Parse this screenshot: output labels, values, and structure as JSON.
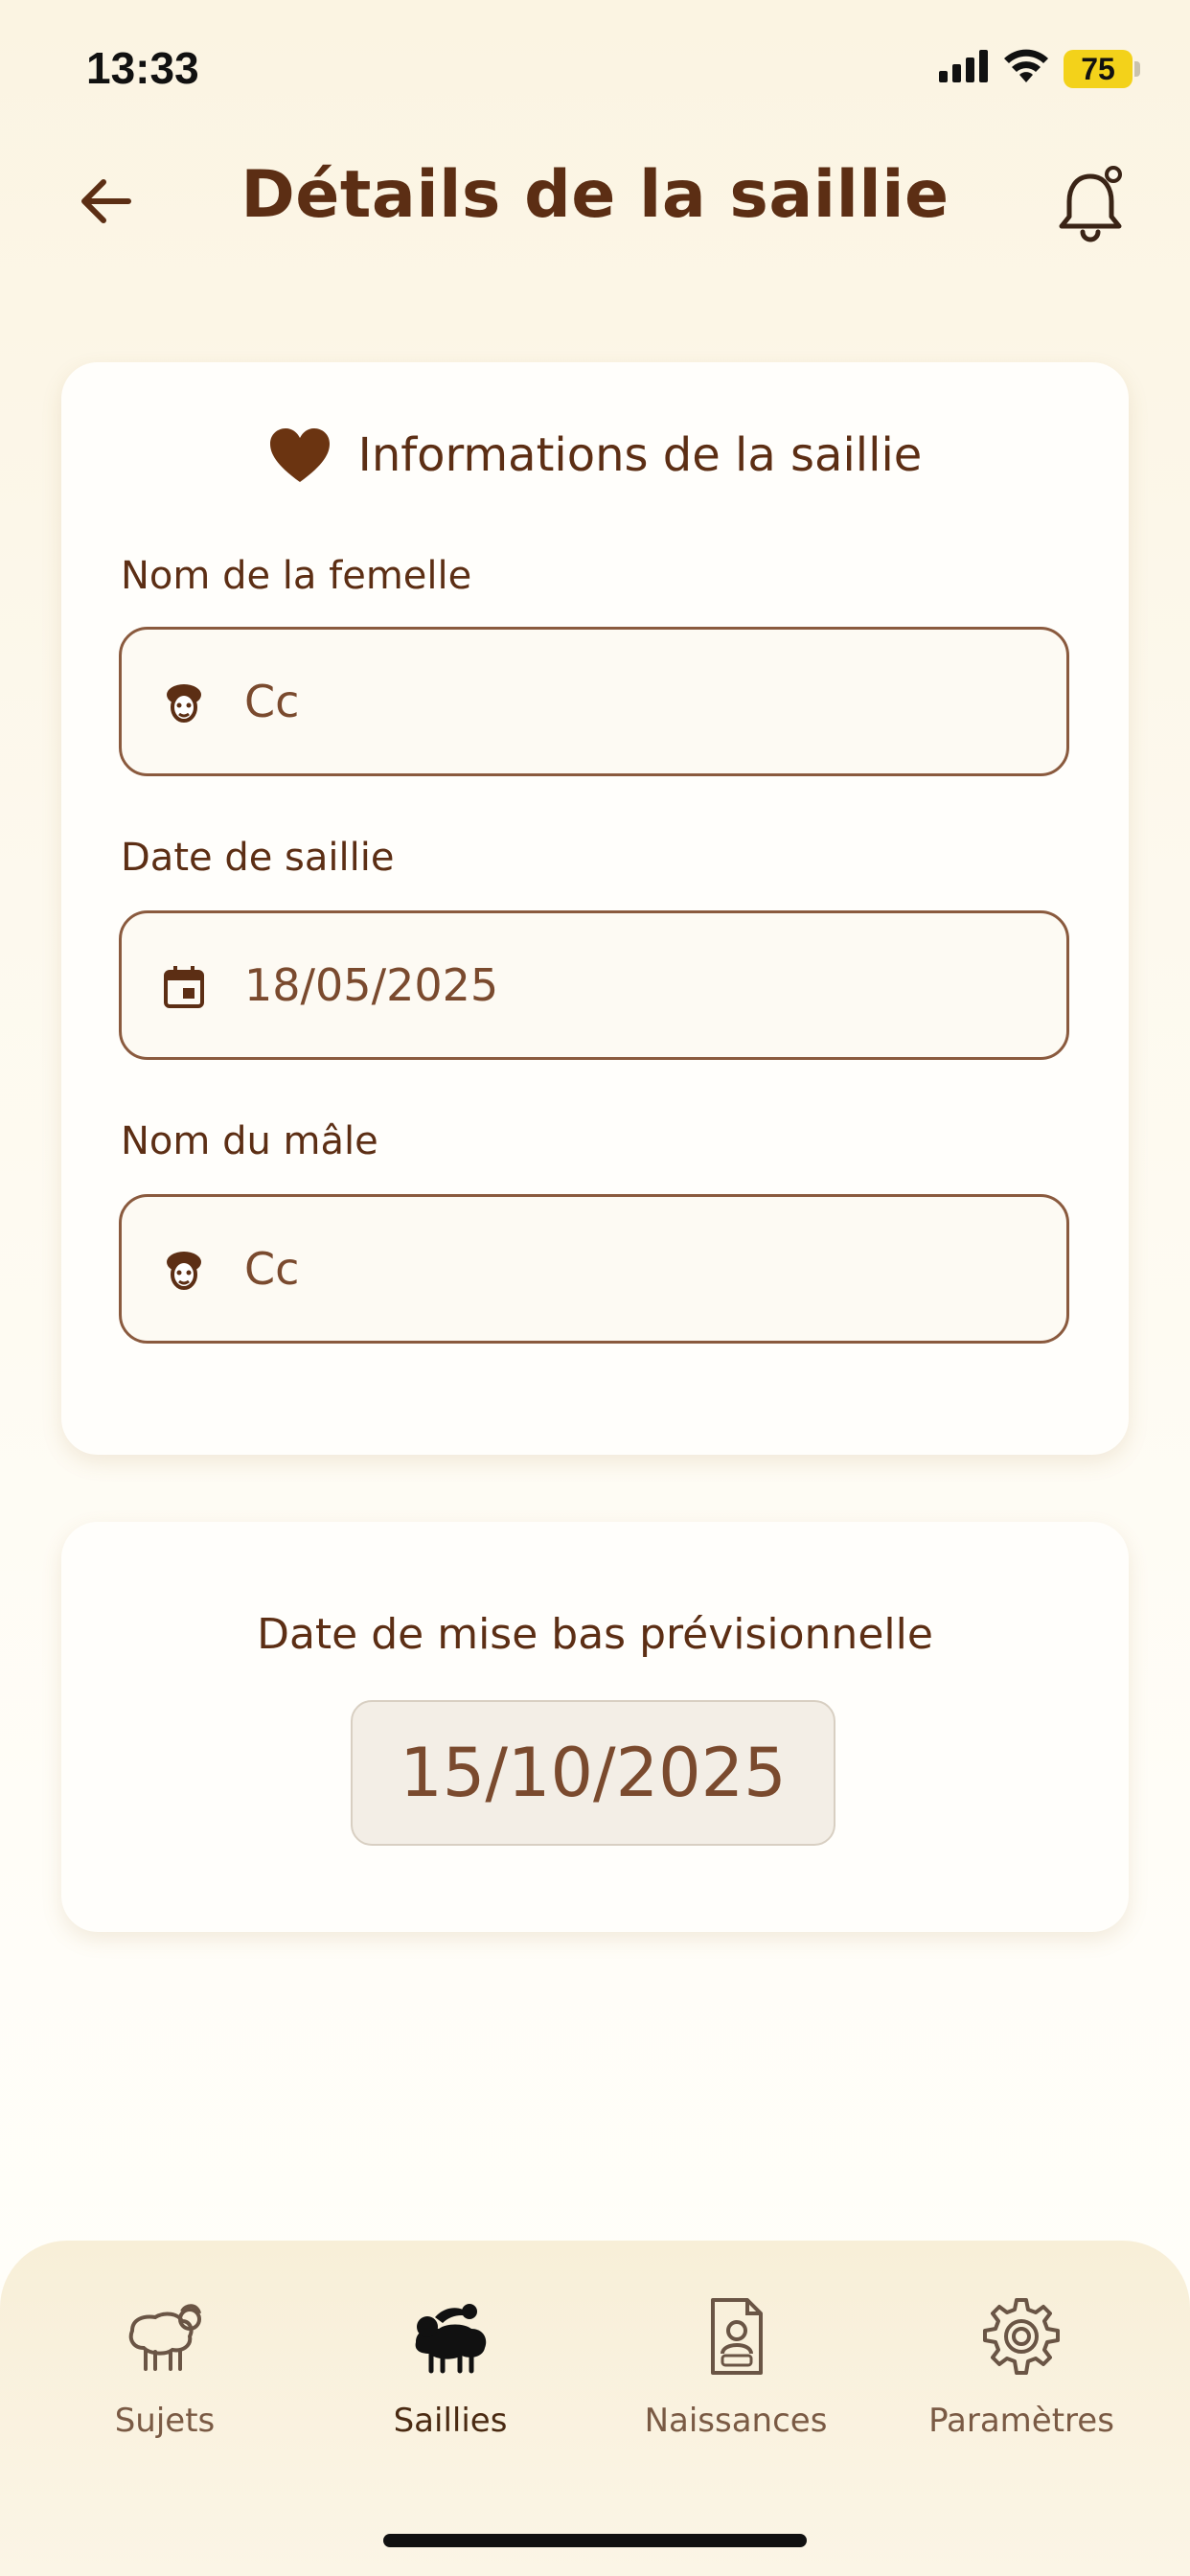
{
  "status_bar": {
    "time": "13:33",
    "battery": "75"
  },
  "header": {
    "title": "Détails de la saillie"
  },
  "info_card": {
    "title": "Informations de la saillie",
    "female_label": "Nom de la femelle",
    "female_value": "Cc",
    "date_label": "Date de saillie",
    "date_value": "18/05/2025",
    "male_label": "Nom du mâle",
    "male_value": "Cc"
  },
  "due_card": {
    "label": "Date de mise bas prévisionnelle",
    "value": "15/10/2025"
  },
  "bottom_nav": {
    "items": [
      {
        "label": "Sujets",
        "icon": "sheep-icon"
      },
      {
        "label": "Saillies",
        "icon": "mating-sheep-icon",
        "active": true
      },
      {
        "label": "Naissances",
        "icon": "birth-document-icon"
      },
      {
        "label": "Paramètres",
        "icon": "gear-icon"
      }
    ]
  },
  "colors": {
    "accent": "#5c2e14",
    "battery": "#f3d21a",
    "field_border": "#8a5a3e"
  }
}
